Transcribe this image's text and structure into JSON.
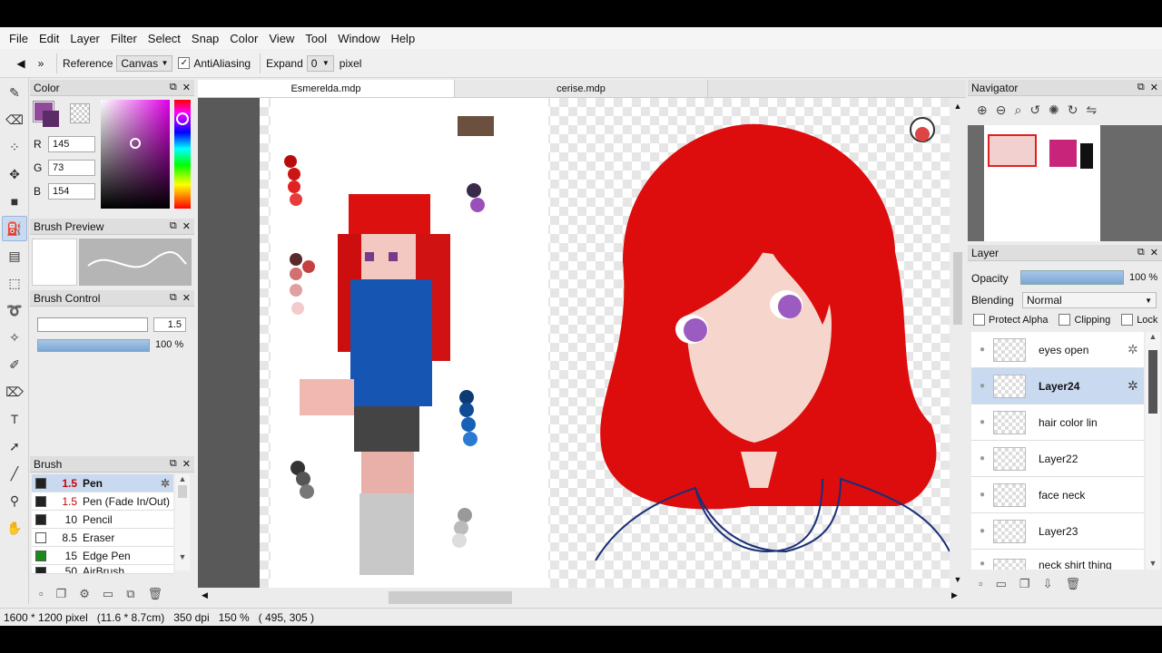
{
  "menu": [
    "File",
    "Edit",
    "Layer",
    "Filter",
    "Select",
    "Snap",
    "Color",
    "View",
    "Tool",
    "Window",
    "Help"
  ],
  "options": {
    "reference_label": "Reference",
    "reference_value": "Canvas",
    "antialias_label": "AntiAliasing",
    "expand_label": "Expand",
    "expand_value": "0",
    "expand_unit": "pixel"
  },
  "color_panel": {
    "title": "Color",
    "r_label": "R",
    "r_value": "145",
    "g_label": "G",
    "g_value": "73",
    "b_label": "B",
    "b_value": "154",
    "main_color": "#91499a"
  },
  "brush_preview": {
    "title": "Brush Preview"
  },
  "brush_control": {
    "title": "Brush Control",
    "size_value": "1.5",
    "opacity_value": "100 %"
  },
  "brush_panel": {
    "title": "Brush",
    "items": [
      {
        "size": "1.5",
        "name": "Pen",
        "color": "#222222"
      },
      {
        "size": "1.5",
        "name": "Pen (Fade In/Out)",
        "color": "#222222"
      },
      {
        "size": "10",
        "name": "Pencil",
        "color": "#222222"
      },
      {
        "size": "8.5",
        "name": "Eraser",
        "color": "#ffffff"
      },
      {
        "size": "15",
        "name": "Edge Pen",
        "color": "#1a8a1a"
      },
      {
        "size": "50",
        "name": "AirBrush",
        "color": "#222222"
      }
    ]
  },
  "tabs": [
    "Esmerelda.mdp",
    "cerise.mdp"
  ],
  "navigator": {
    "title": "Navigator"
  },
  "layer_panel": {
    "title": "Layer",
    "opacity_label": "Opacity",
    "opacity_value": "100 %",
    "blending_label": "Blending",
    "blending_value": "Normal",
    "protect_alpha": "Protect Alpha",
    "clipping": "Clipping",
    "lock": "Lock",
    "layers": [
      {
        "name": "eyes open",
        "selected": false
      },
      {
        "name": "Layer24",
        "selected": true
      },
      {
        "name": "hair color lin",
        "selected": false
      },
      {
        "name": "Layer22",
        "selected": false
      },
      {
        "name": "face neck",
        "selected": false
      },
      {
        "name": "Layer23",
        "selected": false
      },
      {
        "name": "neck shirt thing",
        "selected": false
      }
    ]
  },
  "status": {
    "size": "1600 * 1200 pixel",
    "physical": "(11.6 * 8.7cm)",
    "dpi": "350 dpi",
    "zoom": "150 %",
    "cursor": "( 495, 305 )"
  },
  "colors": {
    "accent": "#c9daf0",
    "hair": "#dd0d0d",
    "skin": "#f6d6cc",
    "shirt": "#1b56b4",
    "outline": "#1a2f78"
  }
}
